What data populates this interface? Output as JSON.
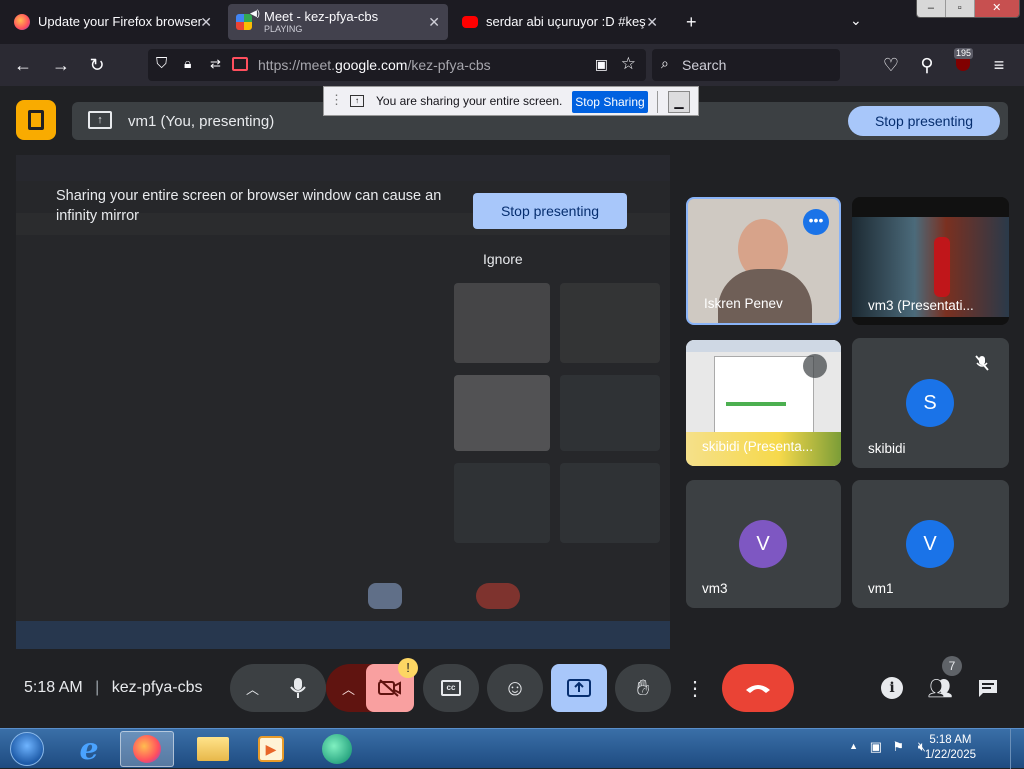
{
  "browser": {
    "tabs": [
      {
        "title": "Update your Firefox browser"
      },
      {
        "title": "Meet - kez-pfya-cbs",
        "subtitle": "PLAYING"
      },
      {
        "title": "serdar abi uçuruyor :D #keşfet"
      }
    ],
    "url_prefix": "https://meet.",
    "url_domain": "google.com",
    "url_path": "/kez-pfya-cbs",
    "search_placeholder": "Search",
    "badge_count": "195"
  },
  "share_banner": {
    "text": "You are sharing your entire screen.",
    "stop_label": "Stop Sharing"
  },
  "meet": {
    "presenting_label": "vm1 (You, presenting)",
    "stop_presenting_label": "Stop presenting",
    "mirror_message": "Sharing your entire screen or browser window can cause an infinity mirror",
    "mirror_stop_label": "Stop presenting",
    "mirror_ignore_label": "Ignore",
    "tiles": [
      {
        "name": "Iskren Penev"
      },
      {
        "name": "vm3 (Presentati..."
      },
      {
        "name": "skibidi (Presenta..."
      },
      {
        "name": "skibidi",
        "initial": "S"
      },
      {
        "name": "vm3",
        "initial": "V"
      },
      {
        "name": "vm1",
        "initial": "V"
      }
    ],
    "time": "5:18 AM",
    "meeting_code": "kez-pfya-cbs",
    "participants_count": "7",
    "colors": {
      "accent": "#a8c7fa",
      "hangup": "#ea4335",
      "avatar_purple": "#7e57c2",
      "avatar_blue": "#1a73e8"
    }
  },
  "taskbar": {
    "time": "5:18 AM",
    "date": "1/22/2025"
  }
}
